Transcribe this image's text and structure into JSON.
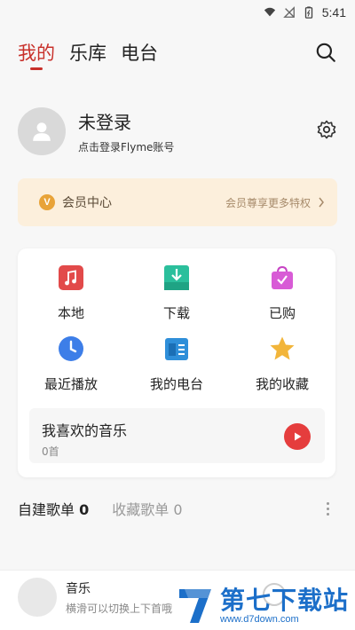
{
  "status_bar": {
    "time": "5:41",
    "icons": [
      "wifi-icon",
      "signal-off-icon",
      "battery-icon"
    ]
  },
  "nav": {
    "tabs": [
      {
        "label": "我的",
        "active": true
      },
      {
        "label": "乐库",
        "active": false
      },
      {
        "label": "电台",
        "active": false
      }
    ],
    "search_icon": "search-icon"
  },
  "profile": {
    "name": "未登录",
    "subtitle": "点击登录Flyme账号",
    "settings_icon": "gear-icon"
  },
  "vip": {
    "badge": "V",
    "title": "会员中心",
    "promo": "会员尊享更多特权"
  },
  "quick_access": [
    {
      "label": "本地",
      "icon": "music-note-icon",
      "color": "#e24a4a"
    },
    {
      "label": "下载",
      "icon": "download-icon",
      "color": "#2bbf9c"
    },
    {
      "label": "已购",
      "icon": "shopping-bag-icon",
      "color": "#d85bd6"
    },
    {
      "label": "最近播放",
      "icon": "clock-icon",
      "color": "#3d7ee8"
    },
    {
      "label": "我的电台",
      "icon": "radio-icon",
      "color": "#2f8fd9"
    },
    {
      "label": "我的收藏",
      "icon": "star-icon",
      "color": "#f2b53a"
    }
  ],
  "favorites": {
    "title": "我喜欢的音乐",
    "count": "0首",
    "play_color": "#e53d3d"
  },
  "playlist_tabs": [
    {
      "label": "自建歌单",
      "count": "0"
    },
    {
      "label": "收藏歌单",
      "count": "0"
    }
  ],
  "mini_player": {
    "title": "音乐",
    "subtitle": "横滑可以切换上下首哦"
  },
  "watermark": {
    "title": "第七下载站",
    "url": "www.d7down.com"
  },
  "colors": {
    "accent": "#c8302a",
    "vip_bg": "#fcefdc",
    "brand_blue": "#1c6fc9"
  }
}
